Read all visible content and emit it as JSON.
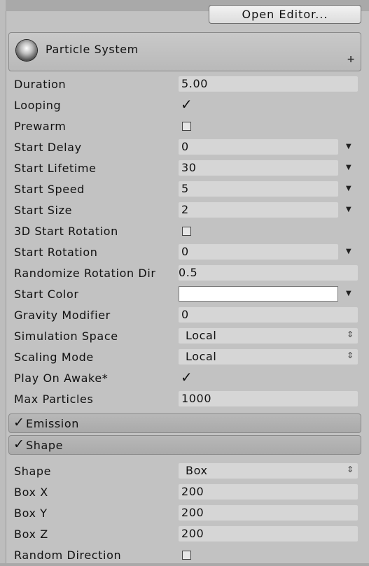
{
  "toolbar": {
    "open_editor_label": "Open Editor..."
  },
  "particle_system": {
    "title": "Particle System",
    "plus": "+"
  },
  "props": {
    "duration": {
      "label": "Duration",
      "value": "5.00"
    },
    "looping": {
      "label": "Looping",
      "checked": true
    },
    "prewarm": {
      "label": "Prewarm",
      "checked": false
    },
    "start_delay": {
      "label": "Start Delay",
      "value": "0"
    },
    "start_lifetime": {
      "label": "Start Lifetime",
      "value": "30"
    },
    "start_speed": {
      "label": "Start Speed",
      "value": "5"
    },
    "start_size": {
      "label": "Start Size",
      "value": "2"
    },
    "rotation_3d": {
      "label": "3D Start Rotation",
      "checked": false
    },
    "start_rotation": {
      "label": "Start Rotation",
      "value": "0"
    },
    "randomize_rotation": {
      "label": "Randomize Rotation Dir",
      "value": "0.5"
    },
    "start_color": {
      "label": "Start Color",
      "color": "#ffffff"
    },
    "gravity": {
      "label": "Gravity Modifier",
      "value": "0"
    },
    "simulation_space": {
      "label": "Simulation Space",
      "value": "Local"
    },
    "scaling_mode": {
      "label": "Scaling Mode",
      "value": "Local"
    },
    "play_on_awake": {
      "label": "Play On Awake*",
      "checked": true
    },
    "max_particles": {
      "label": "Max Particles",
      "value": "1000"
    }
  },
  "modules": {
    "emission": {
      "label": "Emission",
      "enabled": true
    },
    "shape": {
      "label": "Shape",
      "enabled": true
    }
  },
  "shape_props": {
    "shape": {
      "label": "Shape",
      "value": "Box"
    },
    "box_x": {
      "label": "Box X",
      "value": "200"
    },
    "box_y": {
      "label": "Box Y",
      "value": "200"
    },
    "box_z": {
      "label": "Box Z",
      "value": "200"
    },
    "random_direction": {
      "label": "Random Direction",
      "checked": false
    }
  },
  "icons": {
    "check": "✓",
    "dropdown_arrow": "▼",
    "updown": "⇕"
  }
}
